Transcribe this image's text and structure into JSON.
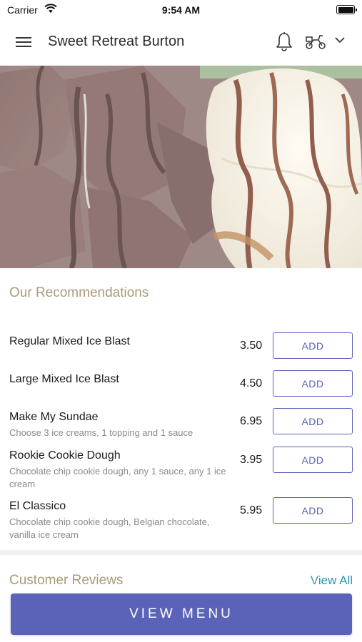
{
  "status_bar": {
    "carrier": "Carrier",
    "time": "9:54 AM"
  },
  "header": {
    "title": "Sweet Retreat Burton",
    "menu_icon": "hamburger-menu-icon",
    "notification_icon": "bell-icon",
    "order_mode_icon": "delivery-scooter-icon",
    "dropdown_icon": "chevron-down-icon"
  },
  "hero": {
    "description_icon": "dessert-photo"
  },
  "recommendations": {
    "title": "Our Recommendations",
    "add_label": "ADD",
    "items": [
      {
        "name": "Regular Mixed Ice Blast",
        "description": "",
        "price": "3.50"
      },
      {
        "name": "Large Mixed Ice Blast",
        "description": "",
        "price": "4.50"
      },
      {
        "name": "Make My Sundae",
        "description": "Choose 3 ice creams, 1 topping and 1 sauce",
        "price": "6.95"
      },
      {
        "name": "Rookie Cookie Dough",
        "description": "Chocolate chip cookie dough, any 1 sauce, any 1 ice cream",
        "price": "3.95"
      },
      {
        "name": "El Classico",
        "description": "Chocolate chip cookie dough, Belgian chocolate, vanilla ice cream",
        "price": "5.95"
      }
    ]
  },
  "reviews": {
    "title": "Customer Reviews",
    "view_all_label": "View All"
  },
  "footer": {
    "view_menu_label": "VIEW MENU"
  },
  "colors": {
    "accent": "#5a63b8",
    "section_title": "#a99b78",
    "link": "#2f96b4"
  }
}
